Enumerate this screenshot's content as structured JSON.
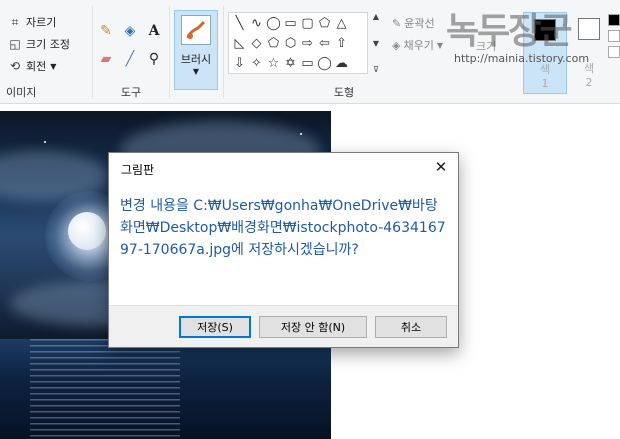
{
  "ribbon": {
    "image": {
      "crop": "자르기",
      "resize": "크기 조정",
      "rotate": "회전",
      "label": "이미지"
    },
    "tools": {
      "label": "도구",
      "icons": [
        "pencil-icon",
        "fill-icon",
        "text-icon",
        "eraser-icon",
        "color-picker-icon",
        "magnifier-icon"
      ]
    },
    "brushes": {
      "label": "브러시"
    },
    "shapes": {
      "label": "도형",
      "outline": "윤곽선",
      "fill": "채우기"
    },
    "size": {
      "label": "크기"
    },
    "colors": {
      "color1": "색\n1",
      "color2": "색\n2",
      "color1_hex": "#000000",
      "color2_hex": "#ffffff"
    },
    "watermark": {
      "big": "녹두장군",
      "url": "http://mainia.tistory.com"
    }
  },
  "dialog": {
    "title": "그림판",
    "message": "변경 내용을 C:₩Users₩gonha₩OneDrive₩바탕 화면₩Desktop₩배경화면₩istockphoto-463416797-170667a.jpg에 저장하시겠습니까?",
    "buttons": {
      "save": "저장(S)",
      "dont_save": "저장 안 함(N)",
      "cancel": "취소"
    }
  }
}
